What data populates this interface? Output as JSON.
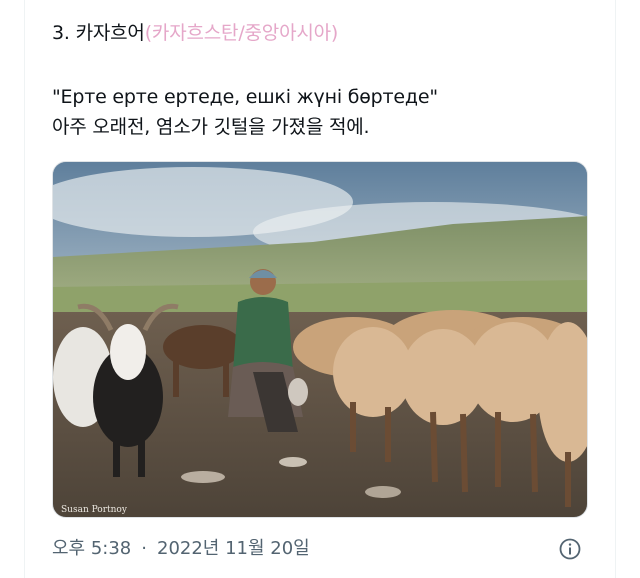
{
  "post": {
    "heading_number": "3.",
    "heading_lang": "카자흐어",
    "heading_region": "(카자흐스탄/중앙아시아)",
    "proverb": "\"Ерте ерте ертеде, ешкі жүні бөртеде\"",
    "translation": "아주 오래전, 염소가 깃털을 가졌을 적에.",
    "photo_credit": "Susan Portnoy",
    "time": "오후 5:38",
    "separator": "·",
    "date": "2022년 11월 20일"
  },
  "icons": {
    "info": "info-icon"
  },
  "colors": {
    "text": "#0f1419",
    "muted": "#536471",
    "paren_accent": "#e5a7c9"
  }
}
